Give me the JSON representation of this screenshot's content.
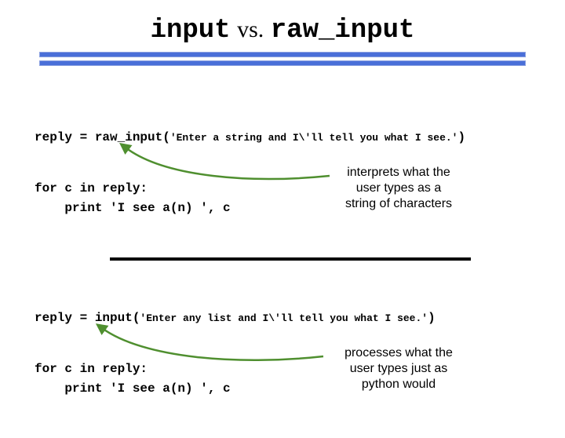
{
  "title": {
    "left": "input",
    "vs": "vs.",
    "right": "raw_input"
  },
  "block1": {
    "assign_head": "reply = raw_input(",
    "prompt": "'Enter a string and I\\'ll tell you what I see.'",
    "assign_tail": ")",
    "loop_l1": "for c in reply:",
    "loop_l2": "    print 'I see a(n) ', c",
    "note_l1": "interprets what the",
    "note_l2": "user types as a",
    "note_l3": "string of characters"
  },
  "block2": {
    "assign_head": "reply = input(",
    "prompt": "'Enter any list and I\\'ll tell you what I see.'",
    "assign_tail": ")",
    "loop_l1": "for c in reply:",
    "loop_l2": "    print 'I see a(n) ', c",
    "note_l1": "processes what the",
    "note_l2": "user types just as",
    "note_l3": "python would"
  }
}
